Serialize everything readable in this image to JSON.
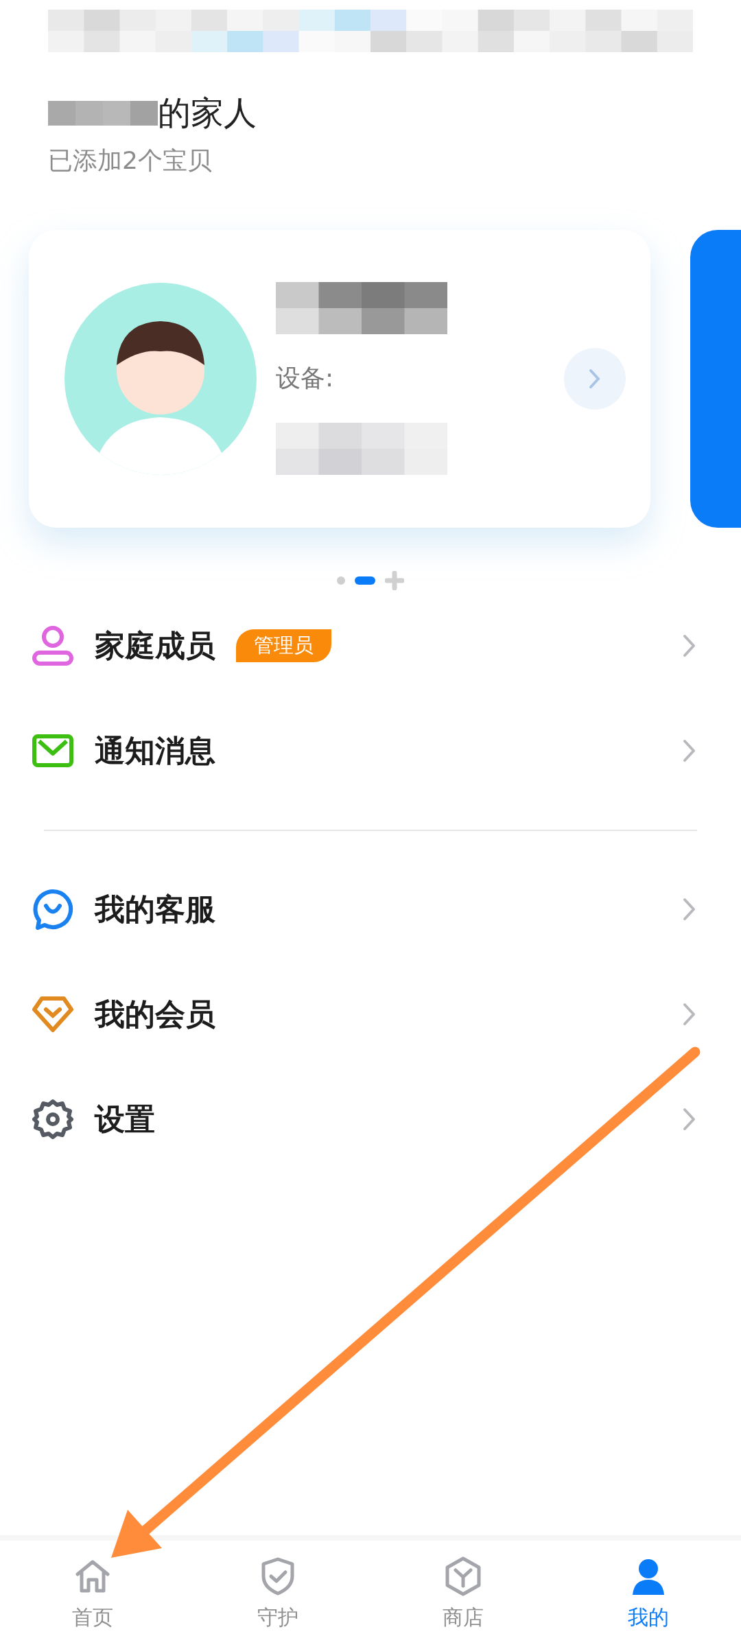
{
  "header": {
    "title": "的家人",
    "subtitle": "已添加2个宝贝"
  },
  "device_card": {
    "device_label": "设备:"
  },
  "pager": [
    {
      "kind": "dot",
      "selected": false
    },
    {
      "kind": "dot",
      "selected": true
    },
    {
      "kind": "add",
      "selected": false
    }
  ],
  "menu_groups": [
    [
      {
        "kind": "members",
        "label": "家庭成员",
        "badge": "管理员"
      },
      {
        "kind": "messages",
        "label": "通知消息"
      }
    ],
    [
      {
        "kind": "service",
        "label": "我的客服"
      },
      {
        "kind": "membership",
        "label": "我的会员"
      },
      {
        "kind": "settings",
        "label": "设置"
      }
    ]
  ],
  "tabs": [
    {
      "kind": "home",
      "label": "首页",
      "selected": false
    },
    {
      "kind": "guard",
      "label": "守护",
      "selected": false
    },
    {
      "kind": "shop",
      "label": "商店",
      "selected": false
    },
    {
      "kind": "mine",
      "label": "我的",
      "selected": true
    }
  ]
}
